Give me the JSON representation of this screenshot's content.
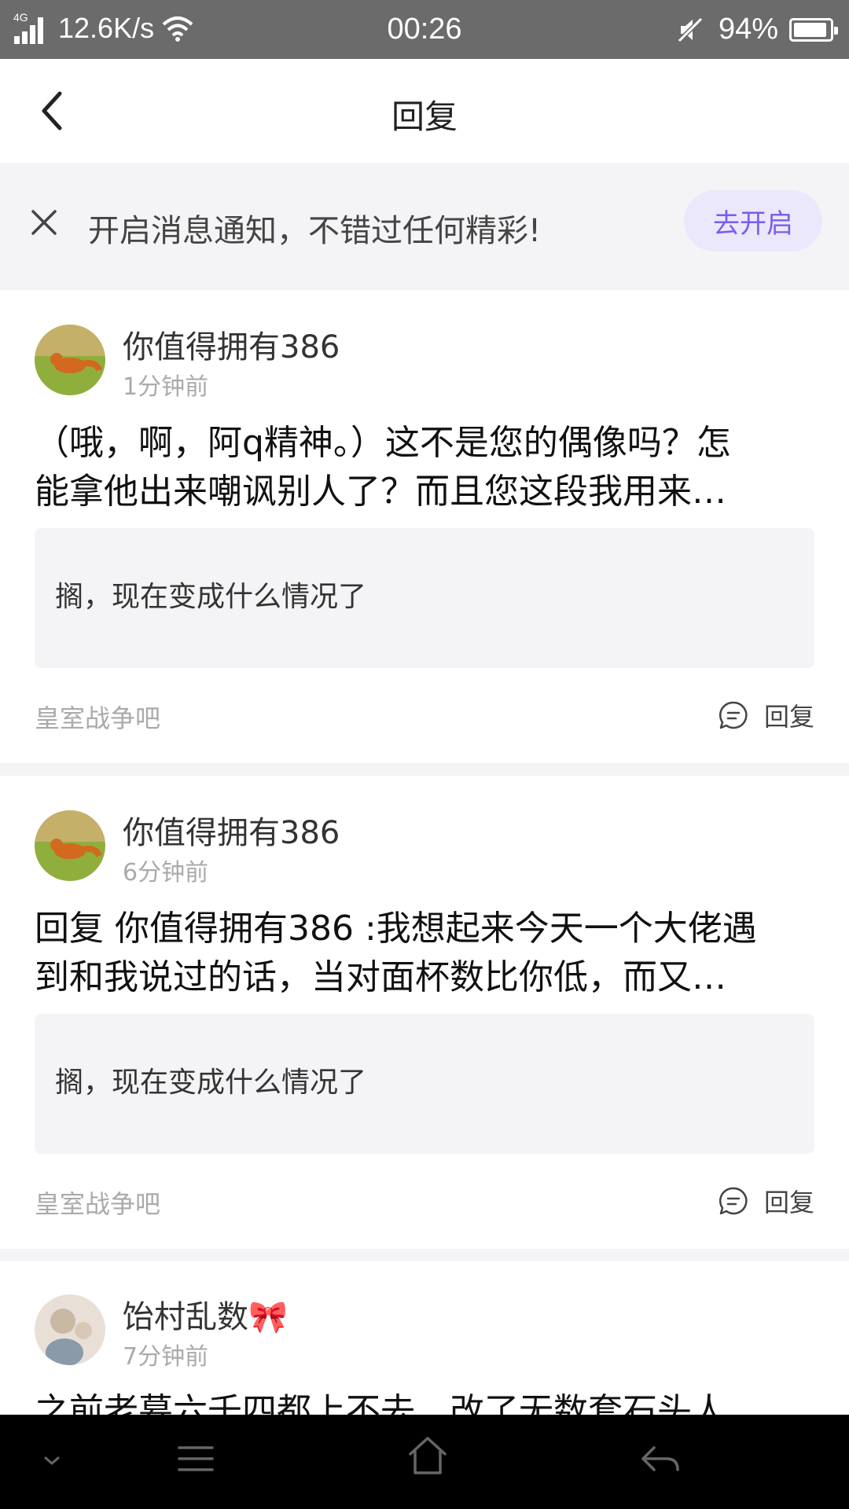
{
  "status_bar": {
    "network": "4G",
    "speed": "12.6K/s",
    "time": "00:26",
    "battery": "94%",
    "battery_level": 0.94
  },
  "header": {
    "title": "回复"
  },
  "notice": {
    "text": "开启消息通知，不错过任何精彩!",
    "button": "去开启"
  },
  "items": [
    {
      "user": "你值得拥有386",
      "time": "1分钟前",
      "content_lines": [
        "（哦，啊，阿q精神。）这不是您的偶像吗？怎",
        "能拿他出来嘲讽别人了？而且您这段我用来…"
      ],
      "quote": "搁，现在变成什么情况了",
      "forum": "皇室战争吧",
      "reply_label": "回复"
    },
    {
      "user": "你值得拥有386",
      "time": "6分钟前",
      "content_lines": [
        "回复 你值得拥有386 :我想起来今天一个大佬遇",
        "到和我说过的话，当对面杯数比你低，而又…"
      ],
      "quote": "搁，现在变成什么情况了",
      "forum": "皇室战争吧",
      "reply_label": "回复"
    },
    {
      "user": "饴村乱数🎀",
      "time": "7分钟前",
      "content_lines": [
        "之前老墓六千四都上不去，改了无数套石头人"
      ]
    }
  ],
  "colors": {
    "accent": "#7a5cf0",
    "accent_bg": "#ebe8fb",
    "banner_bg": "#f4f4f6",
    "status_bar": "#6b6b6b"
  }
}
